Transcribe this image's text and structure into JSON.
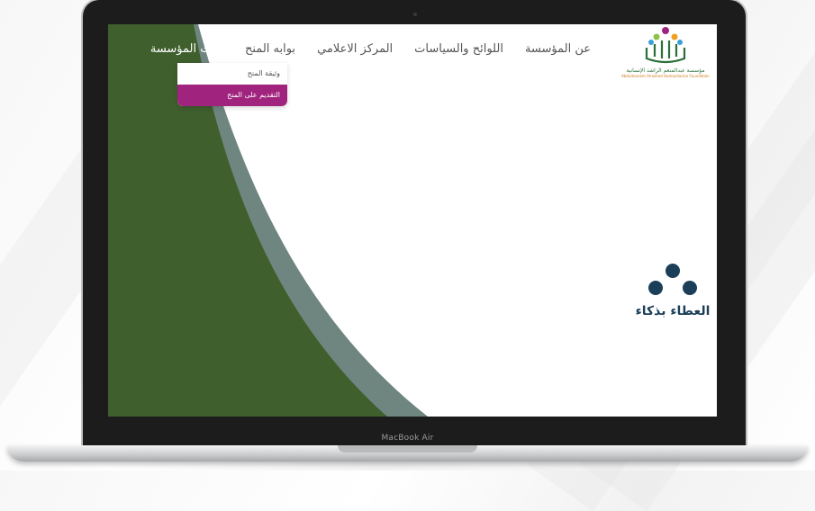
{
  "nav": {
    "items": [
      {
        "label": "عن المؤسسة"
      },
      {
        "label": "اللوائح والسياسات"
      },
      {
        "label": "المركز الاعلامي"
      },
      {
        "label": "بوابه المنح"
      },
      {
        "label": "ازات المؤسسة"
      }
    ],
    "dropdown": {
      "items": [
        {
          "label": "وثيقة المنح",
          "active": false
        },
        {
          "label": "التقديم على المنح",
          "active": true
        }
      ]
    }
  },
  "logo": {
    "arabic": "مؤسسة عبدالمنعم الراشد الإنسانية",
    "english": "Abdulmonem Alrashed Humanitarian Foundation"
  },
  "brand": {
    "tagline": "العطاء بذكاء"
  },
  "device": {
    "label": "MacBook Air"
  },
  "colors": {
    "accent": "#a0237e",
    "green": "#3f5f2d",
    "slate": "#6f8580",
    "navy": "#1b3f58"
  }
}
